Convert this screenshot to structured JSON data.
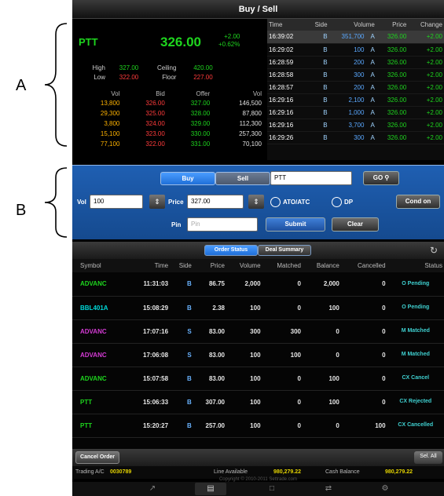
{
  "annotations": {
    "a": "A",
    "b": "B"
  },
  "titlebar": {
    "title": "Buy / Sell"
  },
  "quote": {
    "symbol": "PTT",
    "last": "326.00",
    "change": "+2.00",
    "change_pct": "+0.62%",
    "high_label": "High",
    "high": "327.00",
    "ceiling_label": "Ceiling",
    "ceiling": "420.00",
    "low_label": "Low",
    "low": "322.00",
    "floor_label": "Floor",
    "floor": "227.00",
    "depth_headers": [
      "Vol",
      "Bid",
      "Offer",
      "Vol"
    ],
    "depth": [
      [
        "13,800",
        "326.00",
        "327.00",
        "146,500"
      ],
      [
        "29,300",
        "325.00",
        "328.00",
        "87,800"
      ],
      [
        "3,800",
        "324.00",
        "329.00",
        "112,300"
      ],
      [
        "15,100",
        "323.00",
        "330.00",
        "257,300"
      ],
      [
        "77,100",
        "322.00",
        "331.00",
        "70,100"
      ]
    ]
  },
  "ticks": {
    "headers": [
      "Time",
      "Side",
      "Volume",
      "Price",
      "Change"
    ],
    "rows": [
      [
        "16:39:02",
        "B",
        "351,700",
        "A",
        "326.00",
        "+2.00"
      ],
      [
        "16:29:02",
        "B",
        "100",
        "A",
        "326.00",
        "+2.00"
      ],
      [
        "16:28:59",
        "B",
        "200",
        "A",
        "326.00",
        "+2.00"
      ],
      [
        "16:28:58",
        "B",
        "300",
        "A",
        "326.00",
        "+2.00"
      ],
      [
        "16:28:57",
        "B",
        "200",
        "A",
        "326.00",
        "+2.00"
      ],
      [
        "16:29:16",
        "B",
        "2,100",
        "A",
        "326.00",
        "+2.00"
      ],
      [
        "16:29:16",
        "B",
        "1,000",
        "A",
        "326.00",
        "+2.00"
      ],
      [
        "16:29:16",
        "B",
        "3,700",
        "A",
        "326.00",
        "+2.00"
      ],
      [
        "16:29:26",
        "B",
        "300",
        "A",
        "326.00",
        "+2.00"
      ]
    ]
  },
  "entry": {
    "buy_label": "Buy",
    "sell_label": "Sell",
    "symbol_value": "PTT",
    "search_label": "GO",
    "vol_label": "Vol",
    "vol_value": "100",
    "price_label": "Price",
    "price_value": "327.00",
    "ato_label": "ATO/ATC",
    "dp_label": "DP",
    "cond_label": "Cond on",
    "pin_label": "Pin",
    "pin_placeholder": "Pin",
    "submit_label": "Submit",
    "clear_label": "Clear"
  },
  "status": {
    "tab_order": "Order Status",
    "tab_deal": "Deal Summary",
    "headers": [
      "Symbol",
      "Time",
      "Side",
      "Price",
      "Volume",
      "Matched",
      "Balance",
      "Cancelled",
      "Status"
    ],
    "rows": [
      {
        "sym": "ADVANC",
        "color": "c-green",
        "time": "11:31:03",
        "side": "B",
        "price": "86.75",
        "vol": "2,000",
        "matched": "0",
        "bal": "2,000",
        "cxl": "0",
        "status": "O Pending"
      },
      {
        "sym": "BBL401A",
        "color": "c-cyan",
        "time": "15:08:29",
        "side": "B",
        "price": "2.38",
        "vol": "100",
        "matched": "0",
        "bal": "100",
        "cxl": "0",
        "status": "O Pending"
      },
      {
        "sym": "ADVANC",
        "color": "c-magenta",
        "time": "17:07:16",
        "side": "S",
        "price": "83.00",
        "vol": "300",
        "matched": "300",
        "bal": "0",
        "cxl": "0",
        "status": "M Matched"
      },
      {
        "sym": "ADVANC",
        "color": "c-magenta",
        "time": "17:06:08",
        "side": "S",
        "price": "83.00",
        "vol": "100",
        "matched": "100",
        "bal": "0",
        "cxl": "0",
        "status": "M Matched"
      },
      {
        "sym": "ADVANC",
        "color": "c-green",
        "time": "15:07:58",
        "side": "B",
        "price": "83.00",
        "vol": "100",
        "matched": "0",
        "bal": "100",
        "cxl": "0",
        "status": "CX Cancel"
      },
      {
        "sym": "PTT",
        "color": "c-green",
        "time": "15:06:33",
        "side": "B",
        "price": "307.00",
        "vol": "100",
        "matched": "0",
        "bal": "100",
        "cxl": "0",
        "status": "CX Rejected"
      },
      {
        "sym": "PTT",
        "color": "c-green",
        "time": "15:20:27",
        "side": "B",
        "price": "257.00",
        "vol": "100",
        "matched": "0",
        "bal": "0",
        "cxl": "100",
        "status": "CX Cancelled"
      }
    ]
  },
  "footer": {
    "cancel_order_label": "Cancel Order",
    "select_all_label": "Sel. All",
    "trading_ac_label": "Trading A/C",
    "trading_ac": "0030789",
    "line_label": "Line Available",
    "line_value": "980,279.22",
    "cash_label": "Cash Balance",
    "cash_value": "980,279.22",
    "copyright": "Copyright © 2010-2011 Settrade.com"
  }
}
